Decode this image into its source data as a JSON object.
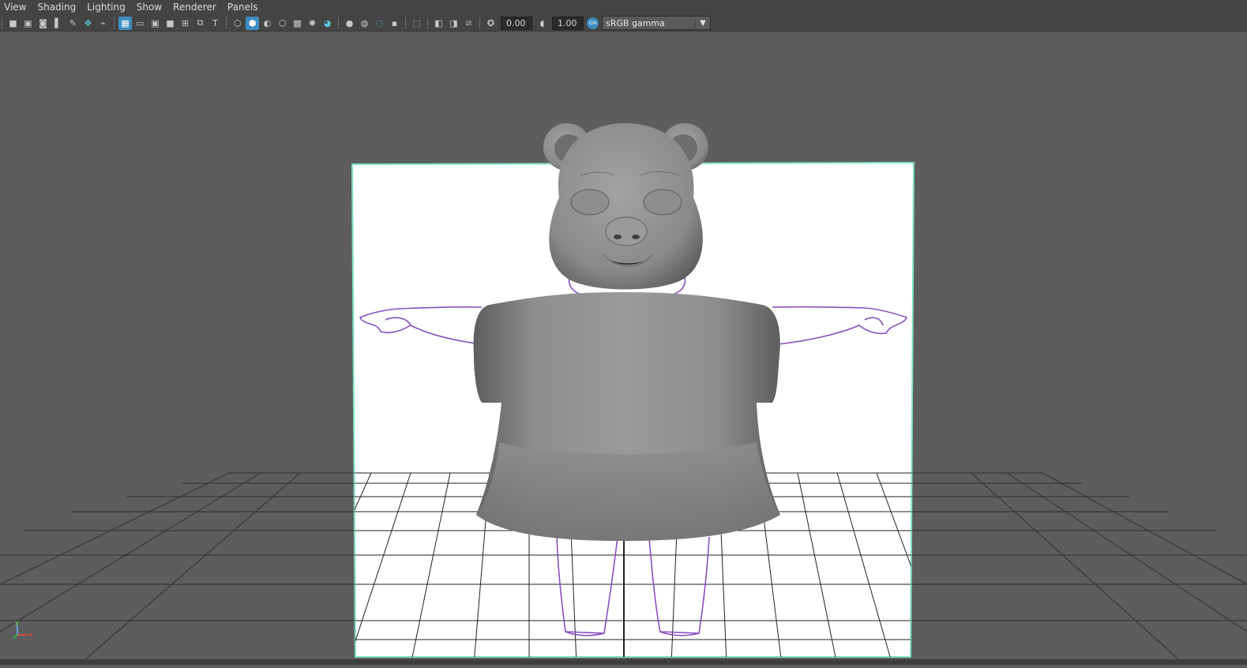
{
  "menubar": {
    "items": [
      {
        "label": "View"
      },
      {
        "label": "Shading"
      },
      {
        "label": "Lighting"
      },
      {
        "label": "Show"
      },
      {
        "label": "Renderer"
      },
      {
        "label": "Panels"
      }
    ]
  },
  "toolbar": {
    "exposure_value": "0.00",
    "gamma_value": "1.00",
    "color_management_badge": "ON",
    "color_space": "sRGB gamma",
    "icons": [
      "camera-icon",
      "camera-attributes-icon",
      "camera-bookmark-icon",
      "image-plane-icon",
      "grease-pencil-icon",
      "two-d-pan-zoom-icon",
      "grid-icon",
      "film-gate-icon",
      "resolution-gate-icon",
      "gate-mask-icon",
      "field-chart-icon",
      "safe-action-icon",
      "safe-title-icon",
      "wireframe-icon",
      "smooth-shade-icon",
      "default-material-icon",
      "shaded-wireframe-icon",
      "textured-icon",
      "lights-icon",
      "shadows-icon",
      "screen-space-ao-icon",
      "motion-blur-icon",
      "anti-aliasing-icon",
      "depth-of-field-icon",
      "isolate-select-icon",
      "xray-icon",
      "xray-active-icon",
      "xray-joints-icon",
      "exposure-icon",
      "gamma-icon",
      "color-management-icon"
    ]
  },
  "viewport": {
    "axis_y_label": "y",
    "axis_x_label": "x",
    "colors": {
      "background": "#5d5d5d",
      "image_plane": "#ffffff",
      "image_plane_border": "#7fe0c4",
      "grid_line": "#2a2a2a",
      "model": "#8a8a8a",
      "sketch": "#8a4fc0"
    }
  }
}
